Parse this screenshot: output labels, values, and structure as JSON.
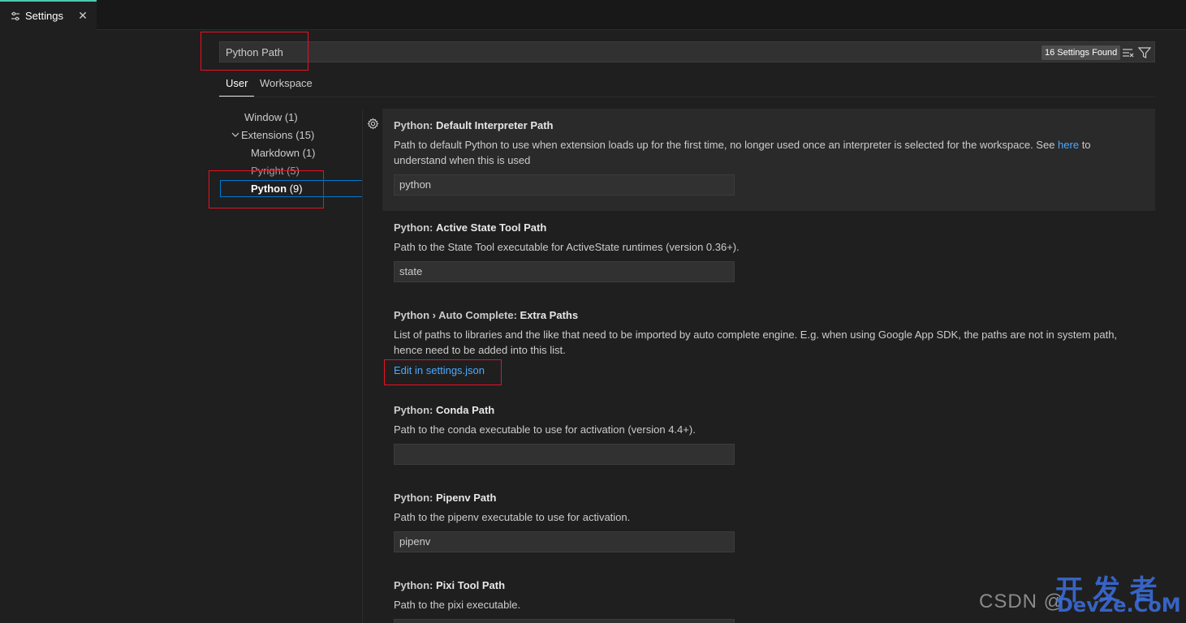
{
  "tab": {
    "label": "Settings",
    "close_glyph": "✕"
  },
  "search": {
    "value": "Python Path",
    "results_badge": "16 Settings Found"
  },
  "scope_tabs": [
    {
      "label": "User",
      "active": true
    },
    {
      "label": "Workspace",
      "active": false
    }
  ],
  "toc": [
    {
      "label": "Window (1)"
    },
    {
      "label": "Extensions (15)",
      "expanded": true
    },
    {
      "label": "Markdown (1)"
    },
    {
      "label": "Pyright (5)"
    },
    {
      "label": "Python",
      "count": "(9)",
      "selected": true
    }
  ],
  "settings": [
    {
      "category": "Python:",
      "name": "Default Interpreter Path",
      "desc_before_link": "Path to default Python to use when extension loads up for the first time, no longer used once an interpreter is selected for the workspace. See ",
      "desc_link": "here",
      "desc_after_link": " to understand when this is used",
      "value": "python"
    },
    {
      "category": "Python:",
      "name": "Active State Tool Path",
      "desc": "Path to the State Tool executable for ActiveState runtimes (version 0.36+).",
      "value": "state"
    },
    {
      "category": "Python › Auto Complete:",
      "name": "Extra Paths",
      "desc": "List of paths to libraries and the like that need to be imported by auto complete engine. E.g. when using Google App SDK, the paths are not in system path, hence need to be added into this list.",
      "link": "Edit in settings.json"
    },
    {
      "category": "Python:",
      "name": "Conda Path",
      "desc": "Path to the conda executable to use for activation (version 4.4+).",
      "value": ""
    },
    {
      "category": "Python:",
      "name": "Pipenv Path",
      "desc": "Path to the pipenv executable to use for activation.",
      "value": "pipenv"
    },
    {
      "category": "Python:",
      "name": "Pixi Tool Path",
      "desc": "Path to the pixi executable.",
      "value": ""
    }
  ],
  "watermark": {
    "csdn": "CSDN @",
    "cn": "开 发 者",
    "com": "DevZe.CoM"
  },
  "colors": {
    "accent": "#0078d4",
    "link": "#4daafc",
    "highlight_box": "#e81123",
    "background": "#1f1f1f"
  },
  "icons": [
    "settings-sliders-icon",
    "close-icon",
    "clear-filter-icon",
    "filter-icon",
    "chevron-down-icon",
    "gear-icon"
  ]
}
